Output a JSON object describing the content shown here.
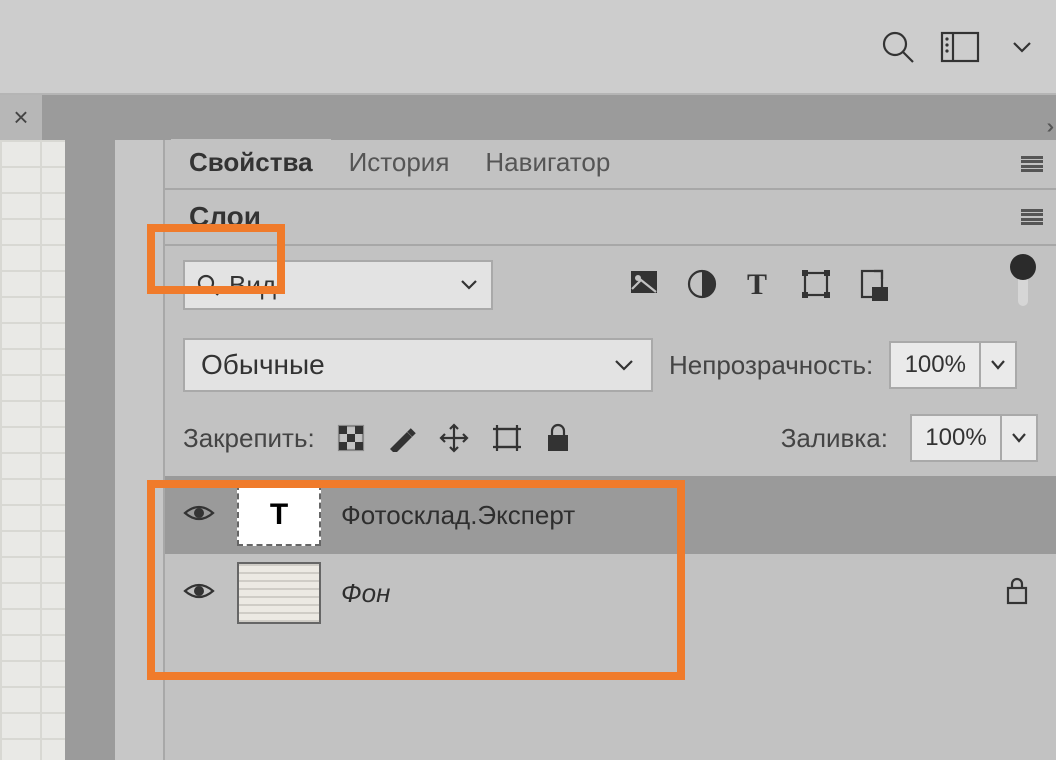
{
  "topbar": {
    "search": "search-icon",
    "panelToggle": "panel-toggle-icon",
    "menu": "chevron-down-icon"
  },
  "fileTab": {
    "close": "×"
  },
  "panelGroup1": {
    "tabs": [
      "Свойства",
      "История",
      "Навигатор"
    ],
    "activeIndex": 0
  },
  "layersPanel": {
    "title": "Слои",
    "filter": {
      "placeholder": "Вид"
    },
    "blendMode": "Обычные",
    "opacity": {
      "label": "Непрозрачность:",
      "value": "100%"
    },
    "lock": {
      "label": "Закрепить:"
    },
    "fill": {
      "label": "Заливка:",
      "value": "100%"
    },
    "layers": [
      {
        "kind": "text",
        "name": "Фотосклад.Эксперт",
        "selected": true,
        "visible": true,
        "locked": false
      },
      {
        "kind": "bg",
        "name": "Фон",
        "selected": false,
        "visible": true,
        "locked": true,
        "italic": true
      }
    ]
  }
}
